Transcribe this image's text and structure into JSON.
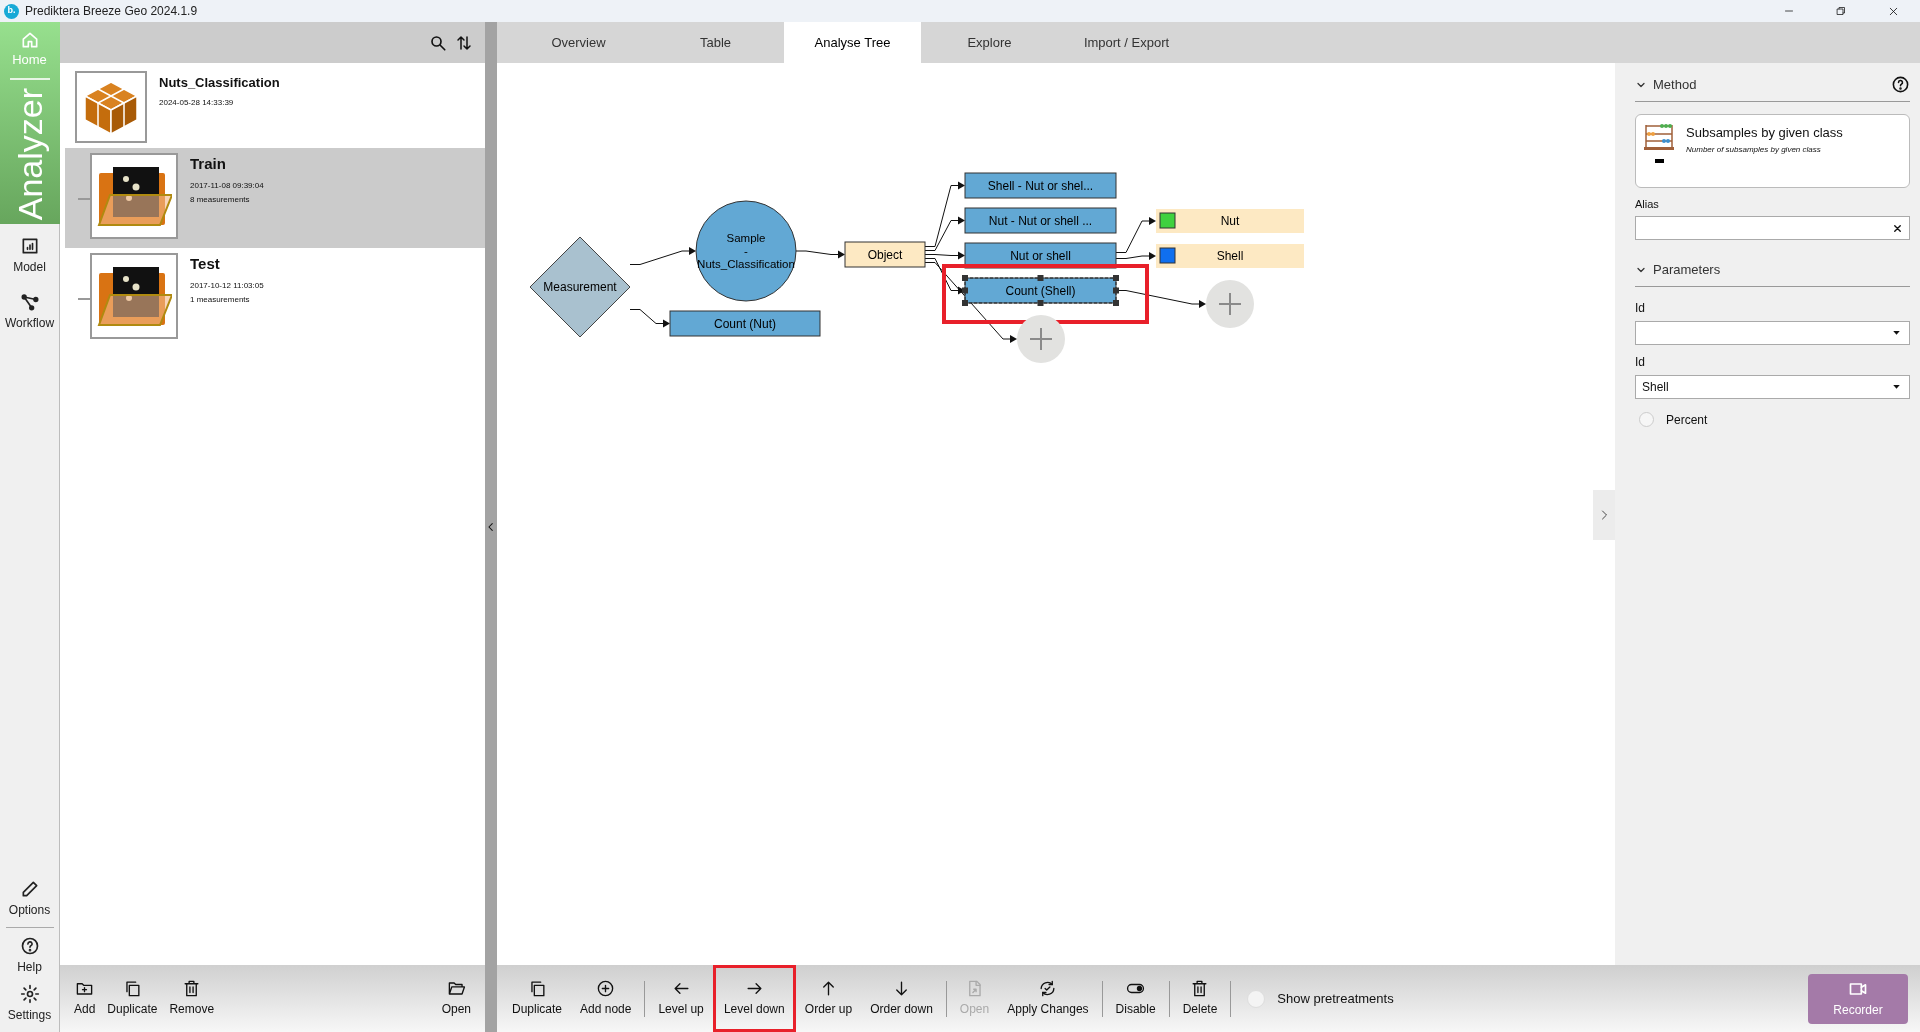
{
  "window": {
    "title": "Prediktera Breeze Geo 2024.1.9",
    "logo": "b."
  },
  "nav": {
    "home": {
      "label": "Home"
    },
    "section": {
      "label": "Analyzer"
    },
    "items": [
      {
        "label": "Model"
      },
      {
        "label": "Workflow"
      }
    ],
    "bottom": [
      {
        "label": "Options"
      },
      {
        "label": "Help"
      },
      {
        "label": "Settings"
      }
    ]
  },
  "project": {
    "name": "Nuts_Classification",
    "date": "2024-05-28 14:33:39",
    "datasets": [
      {
        "name": "Train",
        "date": "2017-11-08 09:39:04",
        "count": "8 measurements",
        "selected": true
      },
      {
        "name": "Test",
        "date": "2017-10-12 11:03:05",
        "count": "1 measurements",
        "selected": false
      }
    ]
  },
  "project_toolbar": {
    "left": [
      {
        "label": "Add"
      },
      {
        "label": "Duplicate"
      },
      {
        "label": "Remove"
      }
    ],
    "right": [
      {
        "label": "Open"
      }
    ]
  },
  "tabs": [
    {
      "label": "Overview",
      "selected": false
    },
    {
      "label": "Table",
      "selected": false
    },
    {
      "label": "Analyse Tree",
      "selected": true
    },
    {
      "label": "Explore",
      "selected": false
    },
    {
      "label": "Import / Export",
      "selected": false
    }
  ],
  "analyse_tree": {
    "root": {
      "kind": "diamond",
      "label": "Measurement",
      "selected": false,
      "highlighted": false,
      "children": [
        {
          "kind": "circle",
          "label_lines": [
            "Sample",
            "-",
            "Nuts_Classification"
          ],
          "selected": false,
          "highlighted": false,
          "children": [
            {
              "kind": "object",
              "label": "Object",
              "selected": false,
              "highlighted": false,
              "children": [
                {
                  "kind": "step",
                  "label": "Shell - Nut or shel...",
                  "selected": false,
                  "highlighted": false
                },
                {
                  "kind": "step",
                  "label": "Nut - Nut or shell ...",
                  "selected": false,
                  "highlighted": false
                },
                {
                  "kind": "step",
                  "label": "Nut or shell",
                  "selected": false,
                  "highlighted": false,
                  "children": [
                    {
                      "kind": "class",
                      "label": "Nut",
                      "color": "#3fd13f",
                      "selected": false,
                      "highlighted": false
                    },
                    {
                      "kind": "class",
                      "label": "Shell",
                      "color": "#0f6fef",
                      "selected": false,
                      "highlighted": false
                    }
                  ]
                },
                {
                  "kind": "step",
                  "label": "Count (Shell)",
                  "selected": true,
                  "highlighted": true,
                  "children": [
                    {
                      "kind": "add",
                      "selected": false,
                      "highlighted": false
                    }
                  ]
                },
                {
                  "kind": "add",
                  "selected": false,
                  "highlighted": false
                }
              ]
            }
          ]
        },
        {
          "kind": "step",
          "label": "Count (Nut)",
          "selected": false,
          "highlighted": false
        }
      ]
    }
  },
  "method_panel": {
    "header": "Method",
    "expanded": true,
    "method": {
      "title": "Subsamples by given class",
      "description": "Number of subsamples by given class"
    },
    "alias": {
      "label": "Alias"
    },
    "parameters": {
      "header": "Parameters",
      "expanded": true,
      "fields": [
        {
          "kind": "select",
          "label": "Id"
        },
        {
          "kind": "select",
          "label": "Id",
          "value": "Shell"
        },
        {
          "kind": "radio",
          "label": "Percent",
          "checked": false
        }
      ]
    }
  },
  "tree_toolbar": {
    "groups": [
      {
        "buttons": [
          {
            "label": "Duplicate",
            "disabled": false,
            "highlighted": false
          },
          {
            "label": "Add node",
            "disabled": false,
            "highlighted": false
          }
        ]
      },
      {
        "buttons": [
          {
            "label": "Level up",
            "disabled": false,
            "highlighted": false
          },
          {
            "label": "Level down",
            "disabled": false,
            "highlighted": true
          },
          {
            "label": "Order up",
            "disabled": false,
            "highlighted": false
          },
          {
            "label": "Order down",
            "disabled": false,
            "highlighted": false
          }
        ]
      },
      {
        "buttons": [
          {
            "label": "Open",
            "disabled": true,
            "highlighted": false
          },
          {
            "label": "Apply Changes",
            "disabled": false,
            "highlighted": false
          }
        ]
      },
      {
        "buttons": [
          {
            "label": "Disable",
            "disabled": false,
            "highlighted": false
          }
        ]
      },
      {
        "buttons": [
          {
            "label": "Delete",
            "disabled": false,
            "highlighted": false
          }
        ]
      }
    ],
    "show_pretreatments": {
      "label": "Show pretreatments",
      "checked": false
    }
  },
  "recorder": {
    "label": "Recorder"
  }
}
